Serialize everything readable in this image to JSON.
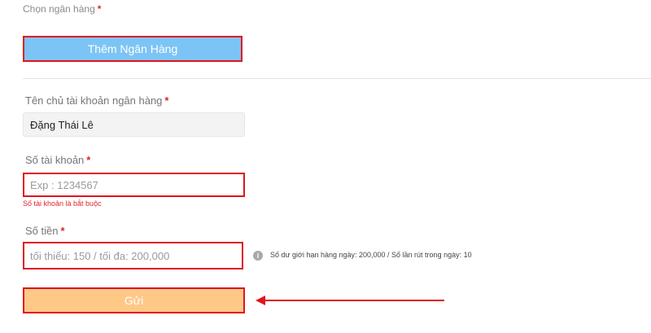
{
  "bank_select": {
    "label": "Chọn ngân hàng",
    "required_mark": "*",
    "add_bank_label": "Thêm Ngân Hàng"
  },
  "account_holder": {
    "label": "Tên chủ tài khoản ngân hàng",
    "required_mark": "*",
    "value": "Đặng Thái Lê"
  },
  "account_number": {
    "label": "Số tài khoản",
    "required_mark": "*",
    "placeholder": "Exp : 1234567",
    "error": "Số tài khoản là bắt buộc"
  },
  "amount": {
    "label": "Số tiền",
    "required_mark": "*",
    "placeholder": "tối thiểu: 150 / tối đa: 200,000",
    "limit_info": "Số dư giới hạn hàng ngày: 200,000 / Số lần rút trong ngày: 10",
    "info_icon": "info-icon"
  },
  "submit": {
    "label": "Gửi"
  },
  "colors": {
    "add_bank_bg": "#7cc4f5",
    "submit_bg": "#fec887",
    "highlight_red": "#e0141e",
    "required_red": "#e0252a"
  }
}
